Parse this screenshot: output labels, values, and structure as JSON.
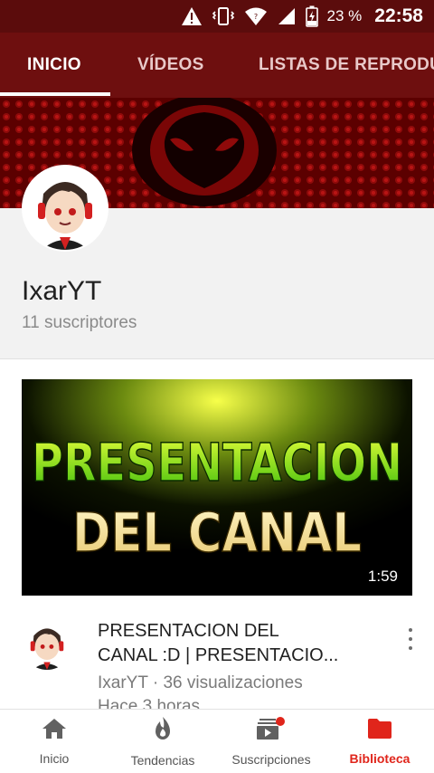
{
  "status_bar": {
    "battery": "23 %",
    "time": "22:58",
    "icons": [
      "warning-icon",
      "vibrate-icon",
      "wifi-icon",
      "cell-signal-icon",
      "battery-charging-icon"
    ]
  },
  "tabs": [
    {
      "label": "INICIO",
      "active": true
    },
    {
      "label": "VÍDEOS",
      "active": false
    },
    {
      "label": "LISTAS DE REPRODU",
      "active": false
    }
  ],
  "channel": {
    "name": "IxarYT",
    "subscribers": "11 suscriptores"
  },
  "video": {
    "thumbnail_text_1": "PRESENTACION",
    "thumbnail_text_2": "DEL CANAL",
    "duration": "1:59",
    "title_line1": "PRESENTACION DEL",
    "title_line2": "CANAL :D | PRESENTACIO...",
    "meta": "IxarYT · 36 visualizaciones",
    "age": "Hace 3 horas"
  },
  "bottom_nav": [
    {
      "label": "Inicio",
      "icon": "home-icon"
    },
    {
      "label": "Tendencias",
      "icon": "flame-icon"
    },
    {
      "label": "Suscripciones",
      "icon": "subscriptions-icon"
    },
    {
      "label": "Biblioteca",
      "icon": "folder-icon",
      "active": true
    }
  ],
  "colors": {
    "status_bar": "#5b0c0c",
    "tab_bar": "#6e0f0f",
    "accent": "#e0251b"
  }
}
